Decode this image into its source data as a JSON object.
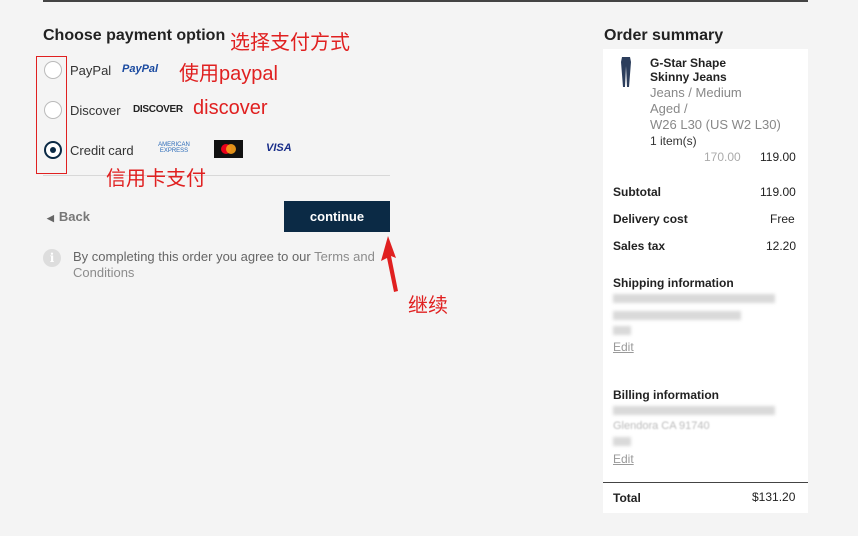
{
  "payment": {
    "title": "Choose payment option",
    "options": [
      {
        "label": "PayPal",
        "logo": "PayPal",
        "selected": false
      },
      {
        "label": "Discover",
        "logo": "DISCOVER",
        "selected": false
      },
      {
        "label": "Credit card",
        "logos": [
          "AMERICAN EXPRESS",
          "mastercard",
          "VISA"
        ],
        "selected": true
      }
    ],
    "back_label": "Back",
    "continue_label": "continue",
    "agree_text": "By completing this order you agree to our",
    "terms_link": "Terms and Conditions"
  },
  "annotations": {
    "choose": "选择支付方式",
    "paypal": "使用paypal",
    "discover": "discover",
    "credit": "信用卡支付",
    "continue": "继续",
    "color": "#e02020"
  },
  "summary": {
    "title": "Order summary",
    "item": {
      "name": "G-Star Shape Skinny Jeans",
      "name_line1": "G-Star Shape",
      "name_line2": "Skinny Jeans",
      "category_line1": "Jeans / Medium",
      "category_line2": "Aged /",
      "size": "W26 L30 (US W2 L30)",
      "qty": "1 item(s)",
      "old_price": "170.00",
      "price": "119.00"
    },
    "subtotal_label": "Subtotal",
    "subtotal": "119.00",
    "delivery_label": "Delivery cost",
    "delivery": "Free",
    "tax_label": "Sales tax",
    "tax": "12.20",
    "shipping_label": "Shipping information",
    "billing_label": "Billing information",
    "billing_partial": "Glendora CA 91740",
    "edit_label": "Edit",
    "total_label": "Total",
    "total": "$131.20"
  },
  "colors": {
    "accent": "#0b2a45",
    "background": "#f4f4f4"
  }
}
